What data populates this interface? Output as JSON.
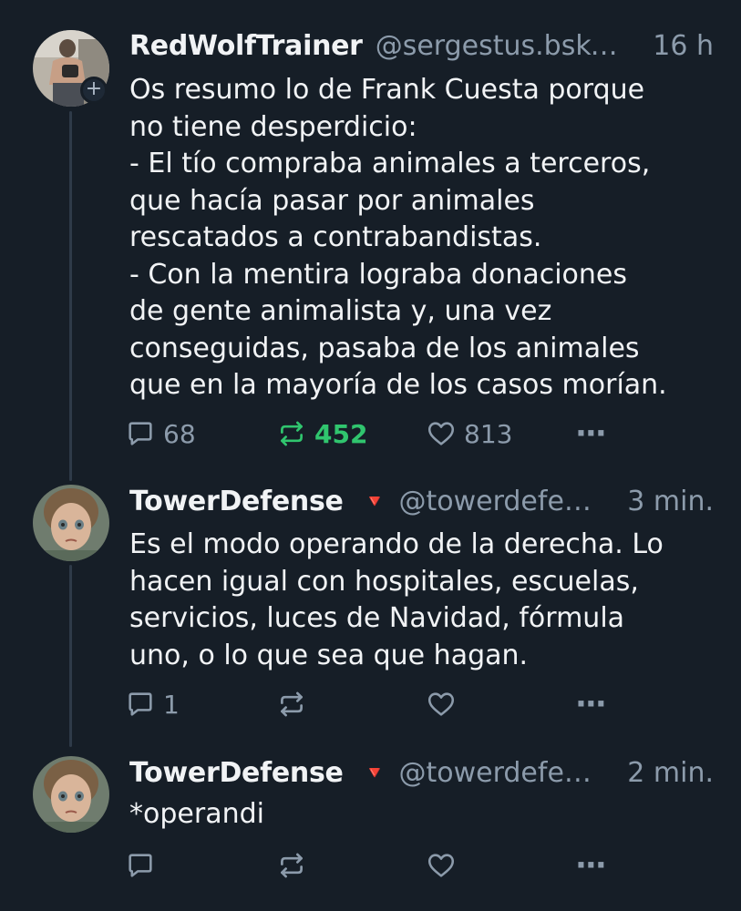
{
  "colors": {
    "background": "#161e27",
    "text": "#f1f3f5",
    "muted": "#8c9bab",
    "repost_active": "#30c56e",
    "badge": "#e0402f"
  },
  "posts": [
    {
      "author": "RedWolfTrainer",
      "handle": "@sergestus.bsky…",
      "time": "16 h",
      "badge": "",
      "follow_icon": "+",
      "text": "Os resumo lo de Frank Cuesta porque\nno tiene desperdicio:\n- El tío compraba animales a terceros,\nque hacía pasar por animales\nrescatados a contrabandistas.\n- Con la mentira lograba donaciones\nde gente animalista y, una vez\nconseguidas, pasaba de los animales\nque en la mayoría de los casos morían.",
      "replies": "68",
      "reposts": "452",
      "likes": "813",
      "reposted": true,
      "more": "···"
    },
    {
      "author": "TowerDefense",
      "handle": "@towerdefe…",
      "time": "3 min.",
      "badge": "🔻",
      "text": "Es el modo operando de la derecha. Lo\nhacen igual con hospitales, escuelas,\nservicios, luces de Navidad, fórmula\nuno, o lo que sea que hagan.",
      "replies": "1",
      "reposts": "",
      "likes": "",
      "more": "···"
    },
    {
      "author": "TowerDefense",
      "handle": "@towerdefe…",
      "time": "2 min.",
      "badge": "🔻",
      "text": "*operandi",
      "replies": "",
      "reposts": "",
      "likes": "",
      "more": "···"
    }
  ]
}
